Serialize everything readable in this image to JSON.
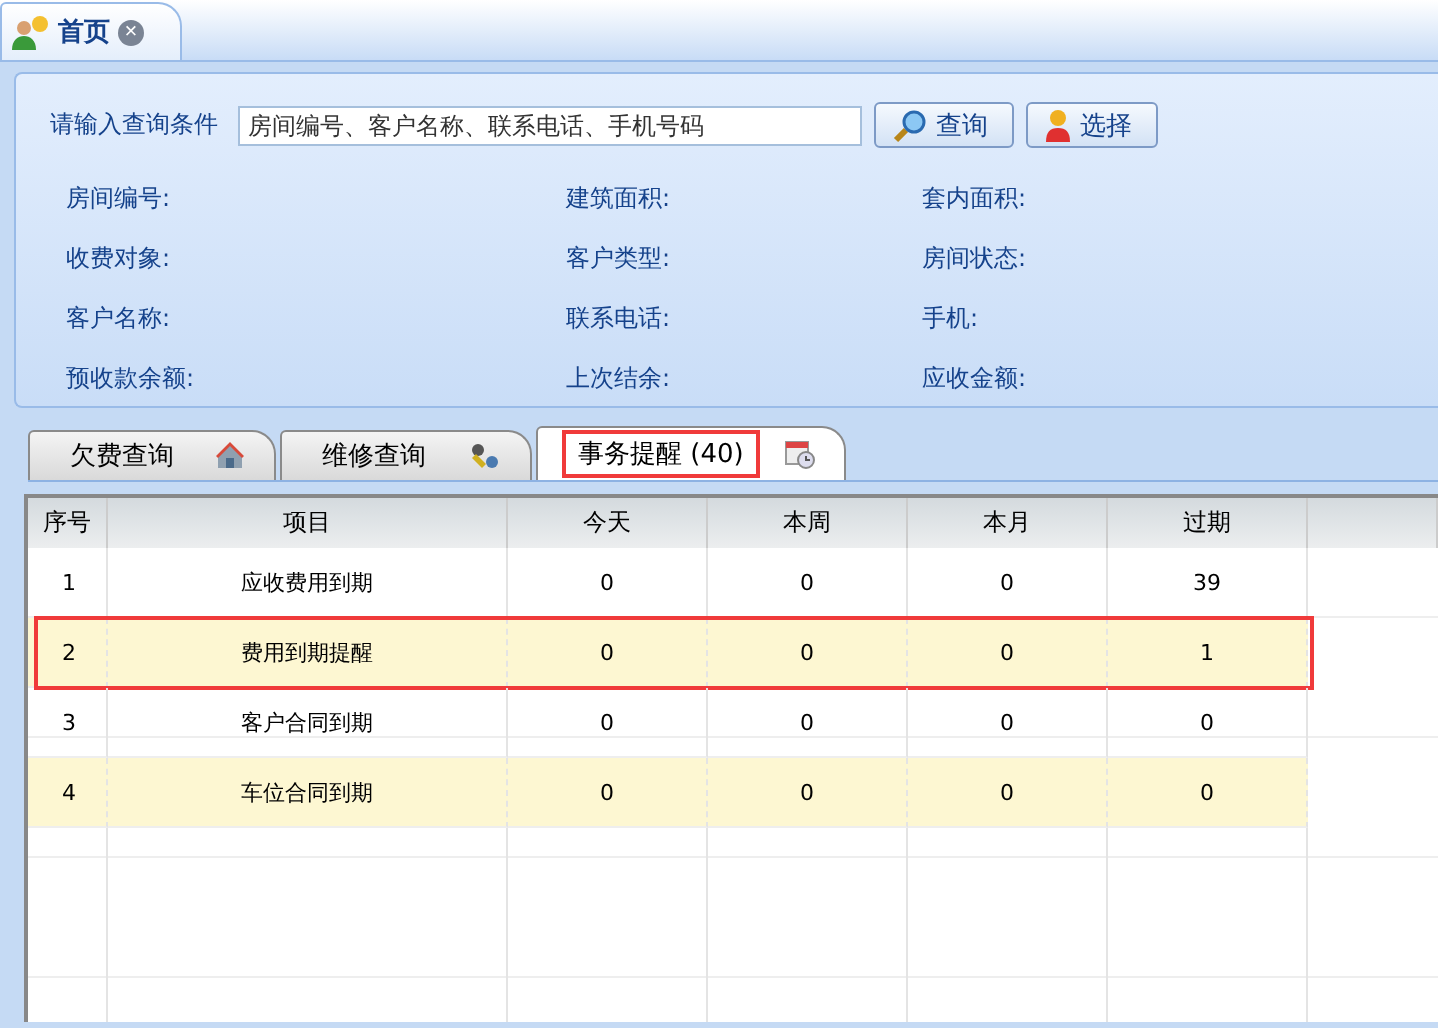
{
  "page_tab": {
    "title": "首页",
    "close": "×"
  },
  "query": {
    "label": "请输入查询条件",
    "placeholder": "房间编号、客户名称、联系电话、手机号码",
    "buttons": [
      "查询",
      "选择"
    ]
  },
  "fields": [
    {
      "label": "房间编号:"
    },
    {
      "label": "建筑面积:"
    },
    {
      "label": "套内面积:"
    },
    {
      "label": "收费对象:"
    },
    {
      "label": "客户类型:"
    },
    {
      "label": "房间状态:"
    },
    {
      "label": "客户名称:"
    },
    {
      "label": "联系电话:"
    },
    {
      "label": "手机:"
    },
    {
      "label": "预收款余额:"
    },
    {
      "label": "上次结余:"
    },
    {
      "label": "应收金额:"
    }
  ],
  "tabs": [
    {
      "label": "欠费查询",
      "selected": false,
      "highlighted": false
    },
    {
      "label": "维修查询",
      "selected": false,
      "highlighted": false
    },
    {
      "label": "事务提醒",
      "count": "(40)",
      "selected": true,
      "highlighted": true
    }
  ],
  "table": {
    "columns": [
      "序号",
      "项目",
      "今天",
      "本周",
      "本月",
      "过期"
    ],
    "rows": [
      {
        "cells": [
          "1",
          "应收费用到期",
          "0",
          "0",
          "0",
          "39"
        ],
        "highlighted": false
      },
      {
        "cells": [
          "2",
          "费用到期提醒",
          "0",
          "0",
          "0",
          "1"
        ],
        "highlighted": true
      },
      {
        "cells": [
          "3",
          "客户合同到期",
          "0",
          "0",
          "0",
          "0"
        ],
        "highlighted": false
      },
      {
        "cells": [
          "4",
          "车位合同到期",
          "0",
          "0",
          "0",
          "0"
        ],
        "highlighted": false
      }
    ]
  }
}
